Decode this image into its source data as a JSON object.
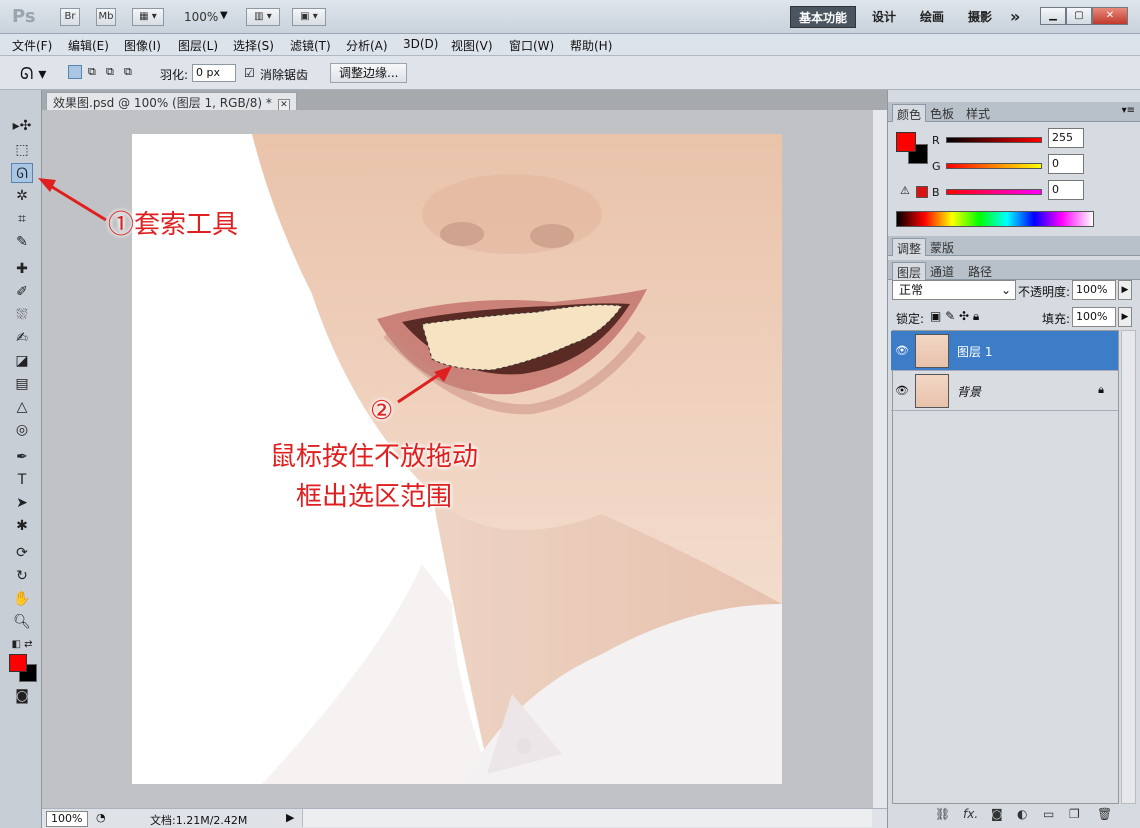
{
  "titlebar": {
    "app_logo": "Ps",
    "br_label": "Br",
    "mb_label": "Mb",
    "zoom": "100%",
    "workspaces": [
      "基本功能",
      "设计",
      "绘画",
      "摄影"
    ],
    "more": "»"
  },
  "menubar": [
    "文件(F)",
    "编辑(E)",
    "图像(I)",
    "图层(L)",
    "选择(S)",
    "滤镜(T)",
    "分析(A)",
    "3D(D)",
    "视图(V)",
    "窗口(W)",
    "帮助(H)"
  ],
  "options": {
    "feather_label": "羽化:",
    "feather_value": "0 px",
    "antialias_label": "消除锯齿",
    "refine_edge_button": "调整边缘..."
  },
  "document": {
    "tab_title": "效果图.psd @ 100% (图层 1, RGB/8) *",
    "zoom": "100%",
    "doc_info": "文档:1.21M/2.42M"
  },
  "annotations": {
    "step1": "①套索工具",
    "step2_num": "②",
    "step2_line1": "鼠标按住不放拖动",
    "step2_line2": "框出选区范围"
  },
  "color_panel": {
    "tabs": [
      "颜色",
      "色板",
      "样式"
    ],
    "r_label": "R",
    "r_value": "255",
    "g_label": "G",
    "g_value": "0",
    "b_label": "B",
    "b_value": "0",
    "fg_color": "#ff0000",
    "bg_color": "#000000"
  },
  "adjust_panel": {
    "tabs": [
      "调整",
      "蒙版"
    ]
  },
  "layers_panel": {
    "tabs": [
      "图层",
      "通道",
      "路径"
    ],
    "blend_mode": "正常",
    "opacity_label": "不透明度:",
    "opacity_value": "100%",
    "lock_label": "锁定:",
    "fill_label": "填充:",
    "fill_value": "100%",
    "layers": [
      {
        "name": "图层 1",
        "selected": true
      },
      {
        "name": "背景",
        "selected": false
      }
    ]
  }
}
